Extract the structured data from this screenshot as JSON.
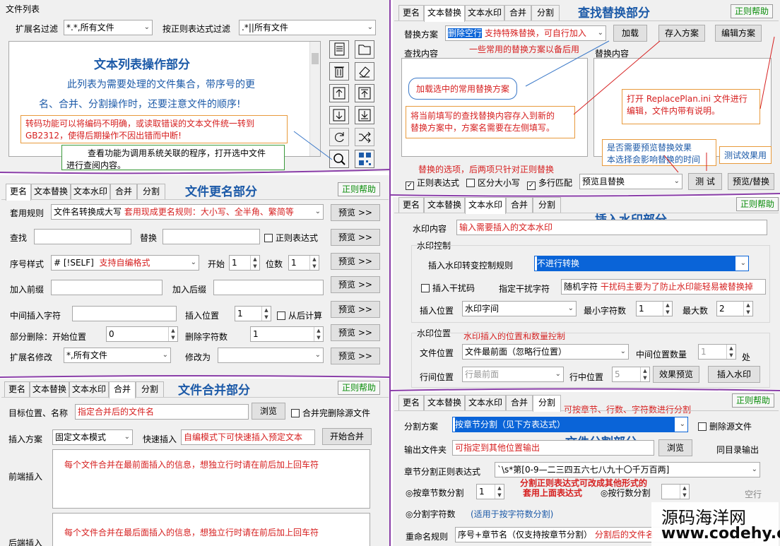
{
  "colors": {
    "purple_divider": "#8a3ea8",
    "section_title": "#1c5aa8",
    "note_red": "#d62020",
    "help_green": "#0a8c0a",
    "selection_blue": "#0a64d8"
  },
  "help": "正则帮助",
  "file_list": {
    "group": "文件列表",
    "ext_filter_label": "扩展名过滤",
    "ext_filter_value": "*.*,所有文件",
    "regex_filter_label": "按正则表达式过滤",
    "regex_filter_value": ".*||所有文件",
    "title": "文本列表操作部分",
    "desc1": "此列表为需要处理的文件集合，带序号的更",
    "desc2": "名、合并、分割操作时，还要注意文件的顺序!",
    "note1a": "转码功能可以将编码不明确，或读取错误的文本文件统一转到",
    "note1b": "GB2312，使得后期操作不因出错而中断!",
    "note2a": "查看功能为调用系统关联的程序，打开选中文件",
    "note2b": "进行查阅内容。",
    "icons": [
      "document-icon",
      "folder-icon",
      "trash-icon",
      "erase-icon",
      "move-up-icon",
      "move-top-icon",
      "move-down-icon",
      "move-bottom-icon",
      "refresh-icon",
      "shuffle-icon",
      "view-icon",
      "qr-code-icon"
    ]
  },
  "rename": {
    "tabs": [
      "更名",
      "文本替换",
      "文本水印",
      "合并",
      "分割"
    ],
    "title": "文件更名部分",
    "rule_label": "套用规则",
    "rule_value": "文件名转换成大写",
    "rule_note": "套用现成更名规则：大小写、全半角、繁简等",
    "find_label": "查找",
    "replace_label": "替换",
    "regex": "正则表达式",
    "serial_label": "序号样式",
    "serial_value": "# [!SELF]",
    "serial_note": "支持自编格式",
    "start_label": "开始",
    "start_value": "1",
    "digits_label": "位数",
    "digits_value": "1",
    "prefix_label": "加入前缀",
    "suffix_label": "加入后缀",
    "mid_label": "中间插入字符",
    "pos_label": "插入位置",
    "pos_value": "1",
    "from_end": "从后计算",
    "del_label": "部分删除：开始位置",
    "del_value": "0",
    "del_count_label": "删除字符数",
    "del_count_value": "1",
    "ext_label": "扩展名修改",
    "ext_value": "*,所有文件",
    "change_label": "修改为",
    "preview": "预览 >>"
  },
  "merge": {
    "tabs": [
      "更名",
      "文本替换",
      "文本水印",
      "合并",
      "分割"
    ],
    "title": "文件合并部分",
    "target_label": "目标位置、名称",
    "target_value": "指定合并后的文件名",
    "browse": "浏览",
    "delete_src": "合并完删除源文件",
    "scheme_label": "插入方案",
    "scheme_value": "固定文本模式",
    "quick_label": "快速插入",
    "quick_note": "自编模式下可快速插入预定文本",
    "start": "开始合并",
    "front_label": "前端插入",
    "front_text": "每个文件合并在最前面插入的信息，想独立行时请在前后加上回车符",
    "back_label": "后端插入",
    "back_text": "每个文件合并在最后面插入的信息，想独立行时请在前后加上回车符"
  },
  "replace": {
    "tabs": [
      "更名",
      "文本替换",
      "文本水印",
      "合并",
      "分割"
    ],
    "title": "查找替换部分",
    "scheme_label": "替换方案",
    "scheme_value": "删除空行",
    "scheme_note": "支持特殊替换，可自行加入",
    "load": "加载",
    "save": "存入方案",
    "edit": "编辑方案",
    "common_note": "一些常用的替换方案以备后用",
    "find_label": "查找内容",
    "replace_label": "替换内容",
    "ann_load": "加载选中的常用替换方案",
    "ann_save_a": "将当前填写的查找替换内容存入到新的",
    "ann_save_b": "替换方案中，方案名需要在左侧填写。",
    "ann_edit_a": "打开 ReplacePlan.ini 文件进行",
    "ann_edit_b": "编辑，文件内带有说明。",
    "ann_preview_a": "是否需要预览替换效果",
    "ann_preview_b": "本选择会影响替换的时间",
    "ann_test": "测试效果用",
    "options_note": "替换的选项，后两项只针对正则替换",
    "regex": "正则表达式",
    "case": "区分大小写",
    "multi": "多行匹配",
    "mode_value": "预览且替换",
    "test": "测 试",
    "run": "预览/替换"
  },
  "watermark": {
    "tabs": [
      "更名",
      "文本替换",
      "文本水印",
      "合并",
      "分割"
    ],
    "title": "插入水印部分",
    "content_label": "水印内容",
    "content_note": "输入需要插入的文本水印",
    "control_group": "水印控制",
    "rule_label": "插入水印转变控制规则",
    "rule_value": "不进行转换",
    "noise": "插入干扰码",
    "noise_label": "指定干扰字符",
    "noise_value": "随机字符",
    "noise_note": "干扰码主要为了防止水印能轻易被替换掉",
    "pos_label": "插入位置",
    "pos_value": "水印字间",
    "min_label": "最小字符数",
    "min_value": "1",
    "max_label": "最大数",
    "max_value": "2",
    "position_group": "水印位置",
    "position_note": "水印插入的位置和数量控制",
    "file_pos_label": "文件位置",
    "file_pos_value": "文件最前面（忽略行位置）",
    "mid_count_label": "中间位置数量",
    "mid_count_value": "1",
    "unit": "处",
    "line_pos_label": "行间位置",
    "line_pos_value": "行最前面",
    "line_mid_label": "行中位置",
    "line_mid_value": "5",
    "effect": "效果预览",
    "insert": "插入水印"
  },
  "split": {
    "tabs": [
      "更名",
      "文本替换",
      "文本水印",
      "合并",
      "分割"
    ],
    "title": "文件分割部分",
    "top_note": "可按章节、行数、字符数进行分割",
    "scheme_label": "分割方案",
    "scheme_value": "按章节分割（见下方表达式）",
    "delete_src": "删除源文件",
    "out_label": "输出文件夹",
    "out_note": "可指定到其他位置输出",
    "browse": "浏览",
    "same": "同目录输出",
    "regex_label": "章节分割正则表达式",
    "regex_value": "`\\s*第[0-9—二三四五六七八九十〇千万百两]",
    "regex_note_a": "分割正则表达式可改成其他形式的",
    "regex_note_b": "套用上面表达式",
    "by_chapter": "按章节数分割",
    "chapter_value": "1",
    "by_lines": "按行数分割",
    "blank": "空行",
    "by_chars": "分割字符数",
    "chars_note": "(适用于按字符数分割)",
    "rename_label": "重命名规则",
    "rename_value": "序号+章节名（仅支持按章节分割）",
    "rename_note": "分割后的文件名"
  },
  "watermark_site": {
    "name": "源码海洋网",
    "url": "www.codehy.com"
  }
}
